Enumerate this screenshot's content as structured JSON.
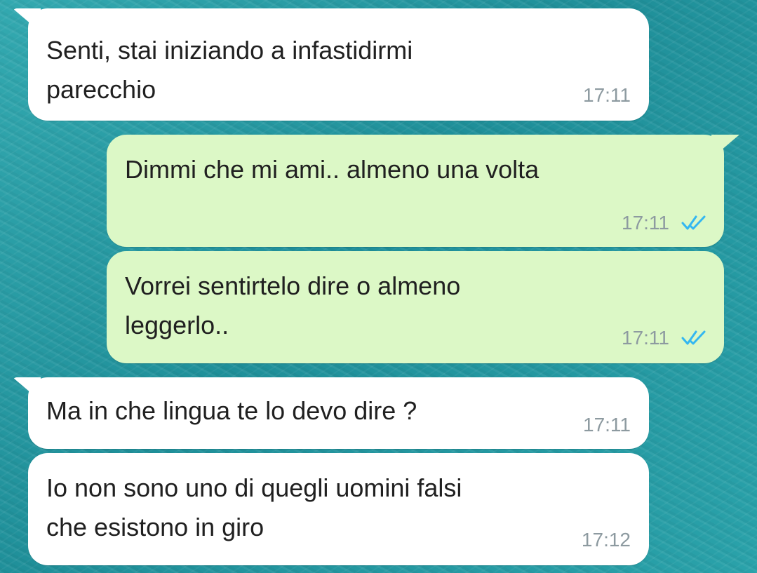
{
  "messages": [
    {
      "direction": "incoming",
      "text": "Senti, stai iniziando a infastidirmi\nparecchio",
      "time": "17:11"
    },
    {
      "direction": "outgoing",
      "text": "Dimmi che mi ami.. almeno una volta",
      "time": "17:11",
      "status": "read"
    },
    {
      "direction": "outgoing",
      "text": "Vorrei sentirtelo dire o almeno\nleggerlo..",
      "time": "17:11",
      "status": "read"
    },
    {
      "direction": "incoming",
      "text": "Ma in che lingua te lo devo dire ?",
      "time": "17:11"
    },
    {
      "direction": "incoming",
      "text": "Io non sono uno di quegli uomini falsi\nche esistono in giro",
      "time": "17:12"
    }
  ],
  "colors": {
    "incoming_bubble": "#ffffff",
    "outgoing_bubble": "#dcf8c6",
    "read_ticks": "#34b7f1",
    "timestamp": "#8d9aa0",
    "background": "#2a9aa3"
  },
  "icons": {
    "read_receipt": "double-check-icon"
  }
}
